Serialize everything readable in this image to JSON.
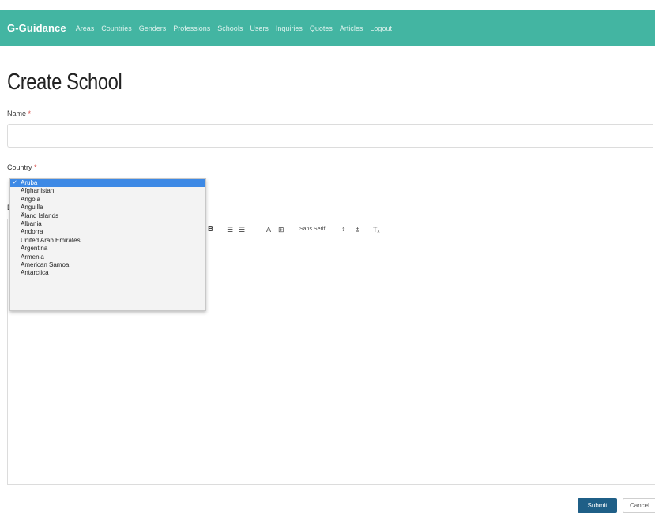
{
  "nav": {
    "brand": "G-Guidance",
    "links": [
      "Areas",
      "Countries",
      "Genders",
      "Professions",
      "Schools",
      "Users",
      "Inquiries",
      "Quotes",
      "Articles",
      "Logout"
    ]
  },
  "page": {
    "title": "Create School"
  },
  "form": {
    "name_label": "Name",
    "country_label": "Country",
    "required_marker": "*",
    "hidden_label_initial": "D",
    "country_options": [
      "Aruba",
      "Afghanistan",
      "Angola",
      "Anguilla",
      "Åland Islands",
      "Albania",
      "Andorra",
      "United Arab Emirates",
      "Argentina",
      "Armenia",
      "American Samoa",
      "Antarctica"
    ],
    "selected_country": "Aruba",
    "check_mark": "✓"
  },
  "editor": {
    "toolbar": {
      "bold_icon": "B",
      "ordered_list": "☰",
      "bullet_list": "☰",
      "font_color": "A",
      "font_background": "⊞",
      "font_family": "Sans Serif",
      "font_family_arrow": "⇕",
      "align": "⩲",
      "clear_format": "Tₓ"
    }
  },
  "buttons": {
    "submit": "Submit",
    "cancel": "Cancel"
  },
  "colors": {
    "navbar": "#43b5a2",
    "submit": "#1f5f87",
    "selected_option": "#3d89e5"
  }
}
